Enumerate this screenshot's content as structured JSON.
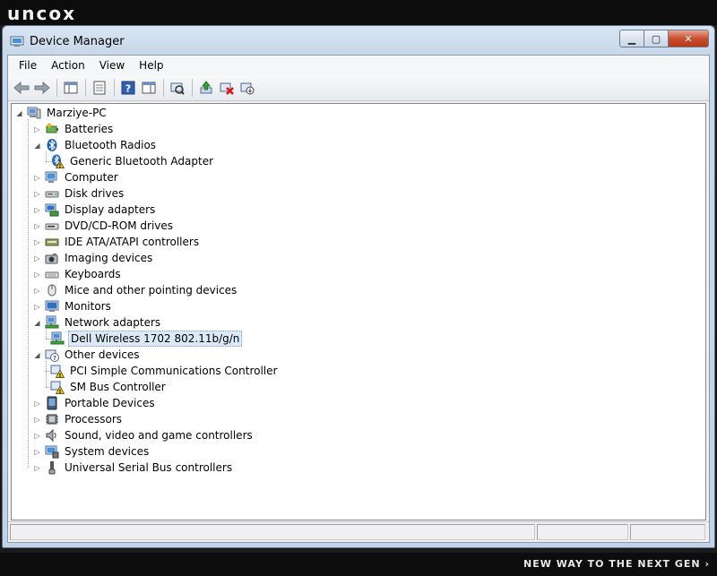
{
  "brand": {
    "logo": "uncox",
    "tagline": "NEW WAY TO THE NEXT GEN ›"
  },
  "window": {
    "title": "Device Manager",
    "minimize_glyph": "▁",
    "maximize_glyph": "▢",
    "close_glyph": "✕"
  },
  "menu": [
    "File",
    "Action",
    "View",
    "Help"
  ],
  "toolbar": {
    "icons": [
      "back-icon",
      "forward-icon",
      "show-hide-console-tree-icon",
      "properties-icon",
      "help-icon",
      "show-action-pane-icon",
      "scan-for-hardware-changes-icon",
      "update-driver-icon",
      "uninstall-icon",
      "disable-icon"
    ]
  },
  "tree": {
    "root": "Marziye-PC",
    "nodes": [
      {
        "label": "Batteries",
        "icon": "battery-icon",
        "expanded": false,
        "children": []
      },
      {
        "label": "Bluetooth Radios",
        "icon": "bluetooth-icon",
        "expanded": true,
        "children": [
          {
            "label": "Generic Bluetooth Adapter",
            "icon": "bluetooth-warning-icon"
          }
        ]
      },
      {
        "label": "Computer",
        "icon": "computer-icon",
        "expanded": false,
        "children": []
      },
      {
        "label": "Disk drives",
        "icon": "disk-drive-icon",
        "expanded": false,
        "children": []
      },
      {
        "label": "Display adapters",
        "icon": "display-adapter-icon",
        "expanded": false,
        "children": []
      },
      {
        "label": "DVD/CD-ROM drives",
        "icon": "dvd-drive-icon",
        "expanded": false,
        "children": []
      },
      {
        "label": "IDE ATA/ATAPI controllers",
        "icon": "ide-controller-icon",
        "expanded": false,
        "children": []
      },
      {
        "label": "Imaging devices",
        "icon": "camera-icon",
        "expanded": false,
        "children": []
      },
      {
        "label": "Keyboards",
        "icon": "keyboard-icon",
        "expanded": false,
        "children": []
      },
      {
        "label": "Mice and other pointing devices",
        "icon": "mouse-icon",
        "expanded": false,
        "children": []
      },
      {
        "label": "Monitors",
        "icon": "monitor-icon",
        "expanded": false,
        "children": []
      },
      {
        "label": "Network adapters",
        "icon": "network-adapter-icon",
        "expanded": true,
        "children": [
          {
            "label": "Dell Wireless 1702 802.11b/g/n",
            "icon": "network-adapter-icon",
            "selected": true
          }
        ]
      },
      {
        "label": "Other devices",
        "icon": "unknown-device-icon",
        "expanded": true,
        "children": [
          {
            "label": "PCI Simple Communications Controller",
            "icon": "device-warning-icon"
          },
          {
            "label": "SM Bus Controller",
            "icon": "device-warning-icon"
          }
        ]
      },
      {
        "label": "Portable Devices",
        "icon": "portable-device-icon",
        "expanded": false,
        "children": []
      },
      {
        "label": "Processors",
        "icon": "processor-icon",
        "expanded": false,
        "children": []
      },
      {
        "label": "Sound, video and game controllers",
        "icon": "speaker-icon",
        "expanded": false,
        "children": []
      },
      {
        "label": "System devices",
        "icon": "system-device-icon",
        "expanded": false,
        "children": []
      },
      {
        "label": "Universal Serial Bus controllers",
        "icon": "usb-icon",
        "expanded": false,
        "children": []
      }
    ]
  },
  "colors": {
    "selection": "#dceaf8",
    "close_button": "#c8502f",
    "warning": "#f5c400"
  }
}
